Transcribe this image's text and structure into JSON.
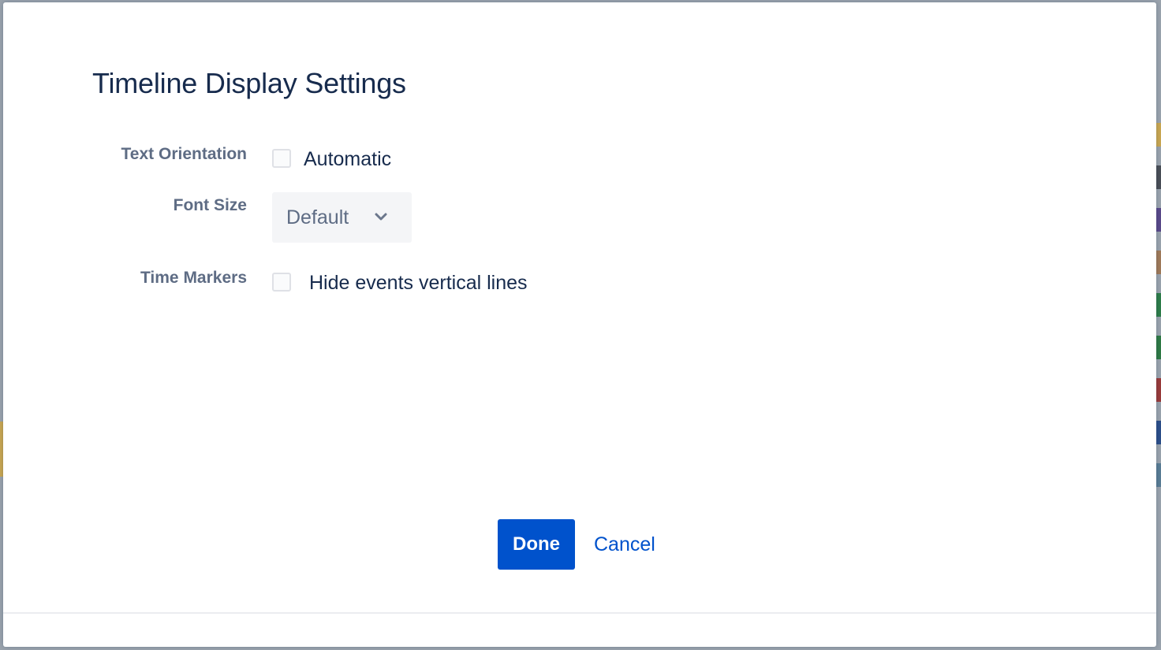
{
  "dialog": {
    "title": "Timeline Display Settings"
  },
  "settings": {
    "text_orientation": {
      "label": "Text Orientation",
      "option_label": "Automatic",
      "checked": false
    },
    "font_size": {
      "label": "Font Size",
      "selected": "Default"
    },
    "time_markers": {
      "label": "Time Markers",
      "option_label": "Hide events vertical lines",
      "checked": false
    }
  },
  "actions": {
    "done_label": "Done",
    "cancel_label": "Cancel"
  },
  "icons": {
    "select_arrow": "chevron-down-icon"
  },
  "colors": {
    "primary": "#0052cc",
    "title_text": "#172b4d",
    "label_text": "#5e6c84",
    "select_background": "#f4f5f7",
    "overlay": "#9aa3ad"
  }
}
